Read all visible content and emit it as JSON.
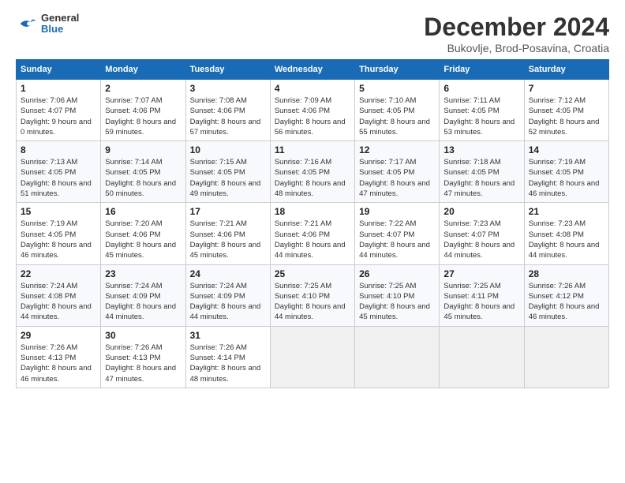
{
  "header": {
    "logo_general": "General",
    "logo_blue": "Blue",
    "month": "December 2024",
    "location": "Bukovlje, Brod-Posavina, Croatia"
  },
  "calendar": {
    "headers": [
      "Sunday",
      "Monday",
      "Tuesday",
      "Wednesday",
      "Thursday",
      "Friday",
      "Saturday"
    ],
    "weeks": [
      [
        {
          "day": "1",
          "sunrise": "Sunrise: 7:06 AM",
          "sunset": "Sunset: 4:07 PM",
          "daylight": "Daylight: 9 hours and 0 minutes."
        },
        {
          "day": "2",
          "sunrise": "Sunrise: 7:07 AM",
          "sunset": "Sunset: 4:06 PM",
          "daylight": "Daylight: 8 hours and 59 minutes."
        },
        {
          "day": "3",
          "sunrise": "Sunrise: 7:08 AM",
          "sunset": "Sunset: 4:06 PM",
          "daylight": "Daylight: 8 hours and 57 minutes."
        },
        {
          "day": "4",
          "sunrise": "Sunrise: 7:09 AM",
          "sunset": "Sunset: 4:06 PM",
          "daylight": "Daylight: 8 hours and 56 minutes."
        },
        {
          "day": "5",
          "sunrise": "Sunrise: 7:10 AM",
          "sunset": "Sunset: 4:05 PM",
          "daylight": "Daylight: 8 hours and 55 minutes."
        },
        {
          "day": "6",
          "sunrise": "Sunrise: 7:11 AM",
          "sunset": "Sunset: 4:05 PM",
          "daylight": "Daylight: 8 hours and 53 minutes."
        },
        {
          "day": "7",
          "sunrise": "Sunrise: 7:12 AM",
          "sunset": "Sunset: 4:05 PM",
          "daylight": "Daylight: 8 hours and 52 minutes."
        }
      ],
      [
        {
          "day": "8",
          "sunrise": "Sunrise: 7:13 AM",
          "sunset": "Sunset: 4:05 PM",
          "daylight": "Daylight: 8 hours and 51 minutes."
        },
        {
          "day": "9",
          "sunrise": "Sunrise: 7:14 AM",
          "sunset": "Sunset: 4:05 PM",
          "daylight": "Daylight: 8 hours and 50 minutes."
        },
        {
          "day": "10",
          "sunrise": "Sunrise: 7:15 AM",
          "sunset": "Sunset: 4:05 PM",
          "daylight": "Daylight: 8 hours and 49 minutes."
        },
        {
          "day": "11",
          "sunrise": "Sunrise: 7:16 AM",
          "sunset": "Sunset: 4:05 PM",
          "daylight": "Daylight: 8 hours and 48 minutes."
        },
        {
          "day": "12",
          "sunrise": "Sunrise: 7:17 AM",
          "sunset": "Sunset: 4:05 PM",
          "daylight": "Daylight: 8 hours and 47 minutes."
        },
        {
          "day": "13",
          "sunrise": "Sunrise: 7:18 AM",
          "sunset": "Sunset: 4:05 PM",
          "daylight": "Daylight: 8 hours and 47 minutes."
        },
        {
          "day": "14",
          "sunrise": "Sunrise: 7:19 AM",
          "sunset": "Sunset: 4:05 PM",
          "daylight": "Daylight: 8 hours and 46 minutes."
        }
      ],
      [
        {
          "day": "15",
          "sunrise": "Sunrise: 7:19 AM",
          "sunset": "Sunset: 4:05 PM",
          "daylight": "Daylight: 8 hours and 46 minutes."
        },
        {
          "day": "16",
          "sunrise": "Sunrise: 7:20 AM",
          "sunset": "Sunset: 4:06 PM",
          "daylight": "Daylight: 8 hours and 45 minutes."
        },
        {
          "day": "17",
          "sunrise": "Sunrise: 7:21 AM",
          "sunset": "Sunset: 4:06 PM",
          "daylight": "Daylight: 8 hours and 45 minutes."
        },
        {
          "day": "18",
          "sunrise": "Sunrise: 7:21 AM",
          "sunset": "Sunset: 4:06 PM",
          "daylight": "Daylight: 8 hours and 44 minutes."
        },
        {
          "day": "19",
          "sunrise": "Sunrise: 7:22 AM",
          "sunset": "Sunset: 4:07 PM",
          "daylight": "Daylight: 8 hours and 44 minutes."
        },
        {
          "day": "20",
          "sunrise": "Sunrise: 7:23 AM",
          "sunset": "Sunset: 4:07 PM",
          "daylight": "Daylight: 8 hours and 44 minutes."
        },
        {
          "day": "21",
          "sunrise": "Sunrise: 7:23 AM",
          "sunset": "Sunset: 4:08 PM",
          "daylight": "Daylight: 8 hours and 44 minutes."
        }
      ],
      [
        {
          "day": "22",
          "sunrise": "Sunrise: 7:24 AM",
          "sunset": "Sunset: 4:08 PM",
          "daylight": "Daylight: 8 hours and 44 minutes."
        },
        {
          "day": "23",
          "sunrise": "Sunrise: 7:24 AM",
          "sunset": "Sunset: 4:09 PM",
          "daylight": "Daylight: 8 hours and 44 minutes."
        },
        {
          "day": "24",
          "sunrise": "Sunrise: 7:24 AM",
          "sunset": "Sunset: 4:09 PM",
          "daylight": "Daylight: 8 hours and 44 minutes."
        },
        {
          "day": "25",
          "sunrise": "Sunrise: 7:25 AM",
          "sunset": "Sunset: 4:10 PM",
          "daylight": "Daylight: 8 hours and 44 minutes."
        },
        {
          "day": "26",
          "sunrise": "Sunrise: 7:25 AM",
          "sunset": "Sunset: 4:10 PM",
          "daylight": "Daylight: 8 hours and 45 minutes."
        },
        {
          "day": "27",
          "sunrise": "Sunrise: 7:25 AM",
          "sunset": "Sunset: 4:11 PM",
          "daylight": "Daylight: 8 hours and 45 minutes."
        },
        {
          "day": "28",
          "sunrise": "Sunrise: 7:26 AM",
          "sunset": "Sunset: 4:12 PM",
          "daylight": "Daylight: 8 hours and 46 minutes."
        }
      ],
      [
        {
          "day": "29",
          "sunrise": "Sunrise: 7:26 AM",
          "sunset": "Sunset: 4:13 PM",
          "daylight": "Daylight: 8 hours and 46 minutes."
        },
        {
          "day": "30",
          "sunrise": "Sunrise: 7:26 AM",
          "sunset": "Sunset: 4:13 PM",
          "daylight": "Daylight: 8 hours and 47 minutes."
        },
        {
          "day": "31",
          "sunrise": "Sunrise: 7:26 AM",
          "sunset": "Sunset: 4:14 PM",
          "daylight": "Daylight: 8 hours and 48 minutes."
        },
        null,
        null,
        null,
        null
      ]
    ]
  }
}
